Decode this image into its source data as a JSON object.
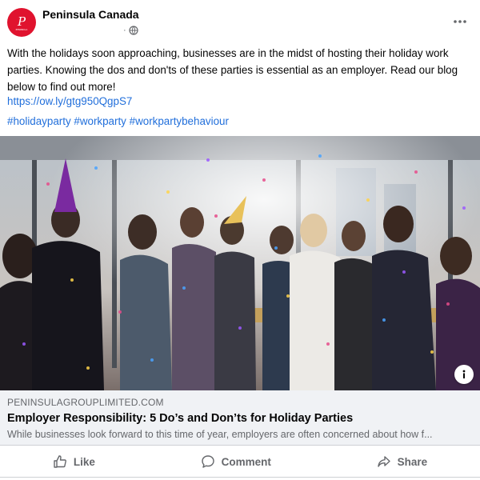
{
  "post": {
    "page_name": "Peninsula Canada",
    "timestamp_dot": "·",
    "avatar_logo_text": "PENINSULA",
    "body_text": "With the holidays soon approaching, businesses are in the midst of hosting their holiday work parties. Knowing the dos and don'ts of these parties is essential as an employer. Read our blog below to find out more!",
    "link": "https://ow.ly/gtg950QgpS7",
    "hashtags": [
      "#holidayparty",
      "#workparty",
      "#workpartybehaviour"
    ]
  },
  "link_card": {
    "domain": "PENINSULAGROUPLIMITED.COM",
    "title": "Employer Responsibility: 5 Do’s and Don’ts for Holiday Parties",
    "description": "While businesses look forward to this time of year, employers are often concerned about how f..."
  },
  "actions": {
    "like": "Like",
    "comment": "Comment",
    "share": "Share"
  },
  "icons": {
    "privacy": "globe-icon",
    "more": "more-options-icon",
    "info": "info-icon",
    "like": "thumbs-up-icon",
    "comment": "comment-bubble-icon",
    "share": "share-arrow-icon"
  },
  "colors": {
    "brand_red": "#e0132e",
    "link_blue": "#216fdb",
    "muted_text": "#65676b",
    "card_bg": "#f0f2f5"
  }
}
